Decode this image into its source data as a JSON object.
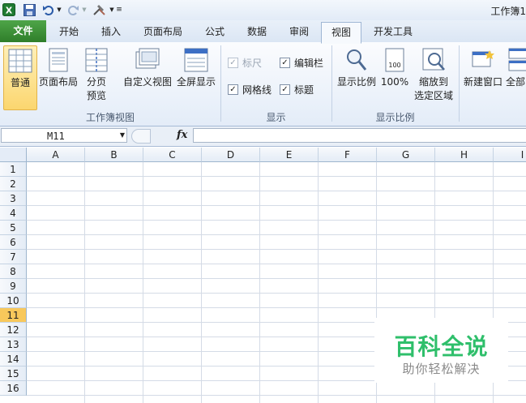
{
  "window": {
    "title": "工作簿1"
  },
  "tabs": [
    {
      "label": "文件"
    },
    {
      "label": "开始"
    },
    {
      "label": "插入"
    },
    {
      "label": "页面布局"
    },
    {
      "label": "公式"
    },
    {
      "label": "数据"
    },
    {
      "label": "审阅"
    },
    {
      "label": "视图"
    },
    {
      "label": "开发工具"
    }
  ],
  "active_tab": "视图",
  "ribbon": {
    "workbook_views": {
      "label": "工作簿视图",
      "normal": "普通",
      "page_layout": "页面布局",
      "page_break_1": "分页",
      "page_break_2": "预览",
      "custom_views": "自定义视图",
      "full_screen": "全屏显示"
    },
    "show": {
      "label": "显示",
      "ruler": {
        "label": "标尺",
        "checked": true,
        "disabled": true
      },
      "formula_bar": {
        "label": "编辑栏",
        "checked": true
      },
      "gridlines": {
        "label": "网格线",
        "checked": true
      },
      "headings": {
        "label": "标题",
        "checked": true
      }
    },
    "zoom": {
      "label": "显示比例",
      "zoom": "显示比例",
      "hundred": "100%",
      "zoom_selection_1": "缩放到",
      "zoom_selection_2": "选定区域"
    },
    "window": {
      "new_window": "新建窗口",
      "arrange_all": "全部"
    }
  },
  "formula_bar": {
    "name_box": "M11",
    "fx": "fx",
    "value": ""
  },
  "grid": {
    "columns": [
      "A",
      "B",
      "C",
      "D",
      "E",
      "F",
      "G",
      "H",
      "I"
    ],
    "rows": [
      "1",
      "2",
      "3",
      "4",
      "5",
      "6",
      "7",
      "8",
      "9",
      "10",
      "11",
      "12",
      "13",
      "14",
      "15",
      "16"
    ],
    "active_row": "11"
  },
  "watermark": {
    "main": "百科全说",
    "sub": "助你轻松解决"
  },
  "colors": {
    "file_tab": "#2f7e2a",
    "selected_button": "#fbd66f",
    "active_row": "#f8c85b",
    "watermark": "#2fbf6b"
  }
}
